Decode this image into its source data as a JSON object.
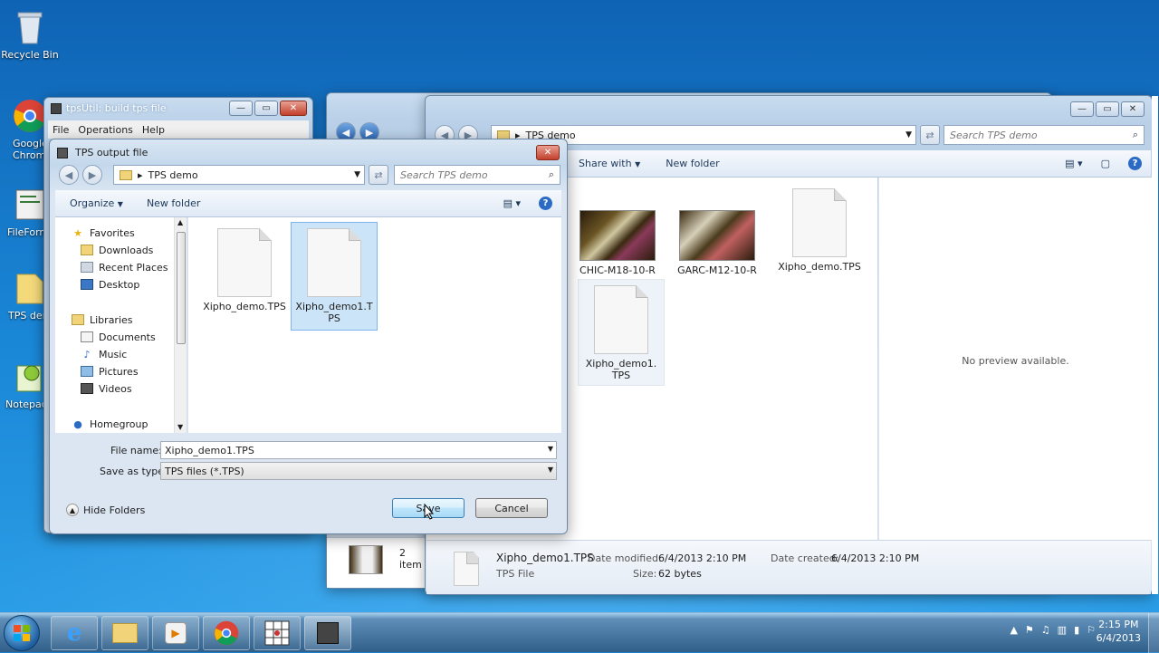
{
  "desktop": {
    "icons": [
      {
        "label": "Recycle Bin"
      },
      {
        "label": "Google Chrom"
      },
      {
        "label": "FileForm"
      },
      {
        "label": "TPS dem"
      },
      {
        "label": "Notepad+"
      }
    ]
  },
  "tpsutil": {
    "title": "tpsUtil: build tps file",
    "menu": [
      "File",
      "Operations",
      "Help"
    ]
  },
  "explorer_back": {
    "status": "2 item"
  },
  "explorer": {
    "address": "TPS demo",
    "search_placeholder": "Search TPS demo",
    "toolbar": {
      "share_with": "Share with",
      "new_folder": "New folder"
    },
    "files": [
      {
        "name": "CHIC-M18-10-R"
      },
      {
        "name": "GARC-M12-10-R"
      },
      {
        "name": "Xipho_demo.TPS"
      },
      {
        "name": "Xipho_demo1.TPS"
      }
    ],
    "preview": "No preview available.",
    "details": {
      "name": "Xipho_demo1.TPS",
      "type": "TPS File",
      "date_modified_label": "Date modified:",
      "date_modified": "6/4/2013 2:10 PM",
      "size_label": "Size:",
      "size": "62 bytes",
      "date_created_label": "Date created:",
      "date_created": "6/4/2013 2:10 PM"
    }
  },
  "dialog": {
    "title": "TPS output file",
    "address": "TPS demo",
    "search_placeholder": "Search TPS demo",
    "toolbar": {
      "organize": "Organize",
      "new_folder": "New folder"
    },
    "nav": {
      "favorites": "Favorites",
      "downloads": "Downloads",
      "recent_places": "Recent Places",
      "desktop": "Desktop",
      "libraries": "Libraries",
      "documents": "Documents",
      "music": "Music",
      "pictures": "Pictures",
      "videos": "Videos",
      "homegroup": "Homegroup"
    },
    "files": [
      {
        "name": "Xipho_demo.TPS"
      },
      {
        "name": "Xipho_demo1.TPS"
      }
    ],
    "file_name_label": "File name:",
    "file_name_value": "Xipho_demo1.TPS",
    "save_as_label": "Save as type:",
    "save_as_value": "TPS files (*.TPS)",
    "hide_folders": "Hide Folders",
    "save_button": "Save",
    "cancel_button": "Cancel"
  },
  "taskbar": {
    "time": "2:15 PM",
    "date": "6/4/2013"
  }
}
